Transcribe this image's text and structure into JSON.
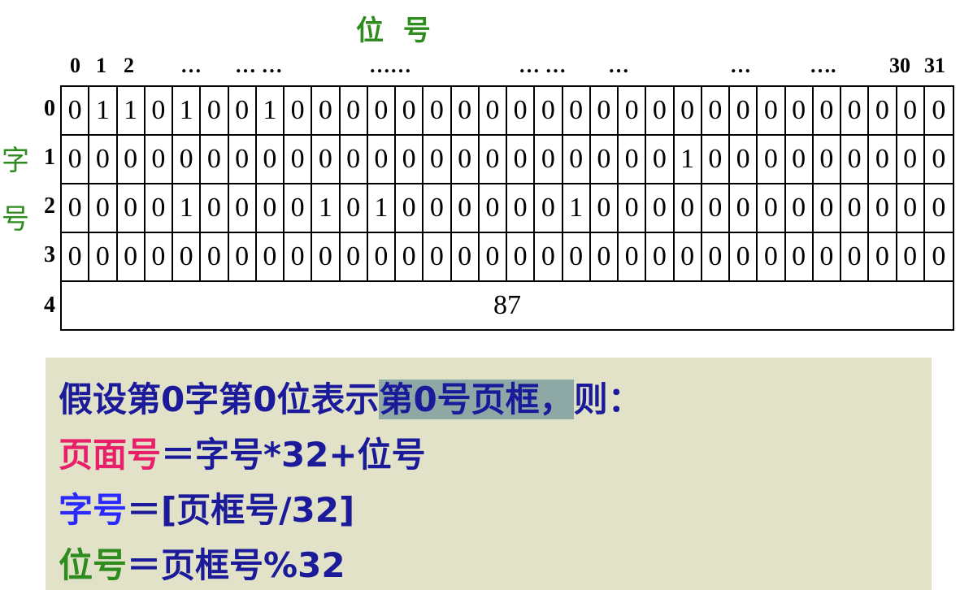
{
  "title": "位 号",
  "word_label": [
    "字",
    "号"
  ],
  "column_labels": [
    "0",
    "1",
    "2",
    "…",
    "… …",
    "……",
    "… …",
    "…",
    "…",
    "….",
    "30",
    "31"
  ],
  "row_labels": [
    "0",
    "1",
    "2",
    "3",
    "4"
  ],
  "bitmap": [
    [
      "0",
      "1",
      "1",
      "0",
      "1",
      "0",
      "0",
      "1",
      "0",
      "0",
      "0",
      "0",
      "0",
      "0",
      "0",
      "0",
      "0",
      "0",
      "0",
      "0",
      "0",
      "0",
      "0",
      "0",
      "0",
      "0",
      "0",
      "0",
      "0",
      "0",
      "0",
      "0"
    ],
    [
      "0",
      "0",
      "0",
      "0",
      "0",
      "0",
      "0",
      "0",
      "0",
      "0",
      "0",
      "0",
      "0",
      "0",
      "0",
      "0",
      "0",
      "0",
      "0",
      "0",
      "0",
      "0",
      "1",
      "0",
      "0",
      "0",
      "0",
      "0",
      "0",
      "0",
      "0",
      "0"
    ],
    [
      "0",
      "0",
      "0",
      "0",
      "1",
      "0",
      "0",
      "0",
      "0",
      "1",
      "0",
      "1",
      "0",
      "0",
      "0",
      "0",
      "0",
      "0",
      "1",
      "0",
      "0",
      "0",
      "0",
      "0",
      "0",
      "0",
      "0",
      "0",
      "0",
      "0",
      "0",
      "0"
    ],
    [
      "0",
      "0",
      "0",
      "0",
      "0",
      "0",
      "0",
      "0",
      "0",
      "0",
      "0",
      "0",
      "0",
      "0",
      "0",
      "0",
      "0",
      "0",
      "0",
      "0",
      "0",
      "0",
      "0",
      "0",
      "0",
      "0",
      "0",
      "0",
      "0",
      "0",
      "0",
      "0"
    ]
  ],
  "free_count": "87",
  "formulas": {
    "line1_a": "假设第0字第0位表示",
    "line1_hl": "第0号页框，",
    "line1_b": "则：",
    "line2_term": "页面号",
    "line2_rest": "＝字号*32+位号",
    "line3_term": "字号",
    "line3_rest": "＝[页框号/32]",
    "line4_term": "位号",
    "line4_rest": "＝页框号%32"
  },
  "colors": {
    "label_green": "#2e8b1e",
    "formula_bg": "#e2e2c8",
    "formula_text": "#1a1a9a",
    "pink": "#e8206a",
    "blue": "#2a2aff",
    "highlight": "#8ea8a6"
  }
}
